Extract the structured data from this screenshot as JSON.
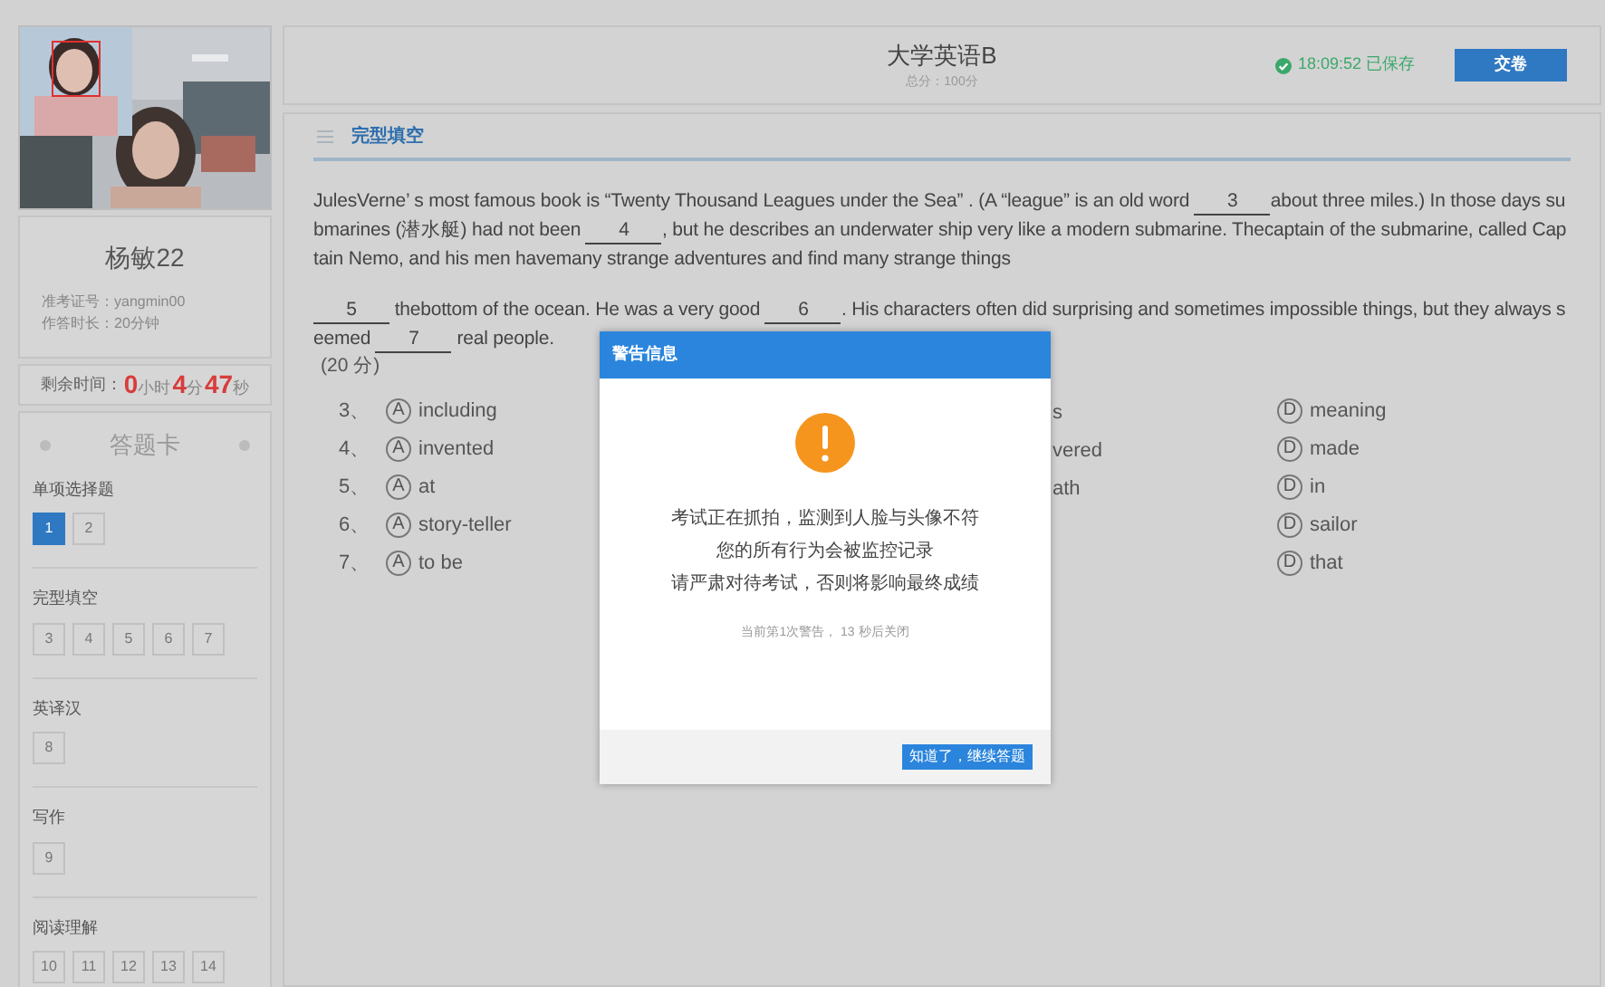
{
  "candidate": {
    "name": "杨敏22",
    "id_label": "准考证号：yangmin00",
    "duration_label": "作答时长：20分钟"
  },
  "timer": {
    "label": "剩余时间：",
    "parts": [
      {
        "value": "0",
        "unit": "小时"
      },
      {
        "value": "4",
        "unit": "分"
      },
      {
        "value": "47",
        "unit": "秒"
      }
    ]
  },
  "answer_card": {
    "title": "答题卡",
    "groups": [
      {
        "title": "单项选择题",
        "items": [
          {
            "label": "1",
            "selected": true
          },
          {
            "label": "2",
            "selected": false
          }
        ]
      },
      {
        "title": "完型填空",
        "items": [
          {
            "label": "3",
            "selected": false
          },
          {
            "label": "4",
            "selected": false
          },
          {
            "label": "5",
            "selected": false
          },
          {
            "label": "6",
            "selected": false
          },
          {
            "label": "7",
            "selected": false
          }
        ]
      },
      {
        "title": "英译汉",
        "items": [
          {
            "label": "8",
            "selected": false
          }
        ]
      },
      {
        "title": "写作",
        "items": [
          {
            "label": "9",
            "selected": false
          }
        ]
      },
      {
        "title": "阅读理解",
        "items": [
          {
            "label": "10",
            "selected": false
          },
          {
            "label": "11",
            "selected": false
          },
          {
            "label": "12",
            "selected": false
          },
          {
            "label": "13",
            "selected": false
          },
          {
            "label": "14",
            "selected": false
          }
        ]
      }
    ]
  },
  "header": {
    "title": "大学英语B",
    "subtitle": "总分：100分",
    "saved": "18:09:52 已保存",
    "submit": "交卷"
  },
  "section": {
    "title": "完型填空"
  },
  "passage": [
    [
      {
        "text": "JulesVerne’ s most famous book is  “Twenty Thousand Leagues under the Sea” . (A  “league”  is an old word "
      },
      {
        "blank": "3"
      },
      {
        "text": "about three miles.) In those days submarines (潜水艇) had not been "
      },
      {
        "blank": "4"
      },
      {
        "text": ", but he describes an underwater ship very like a modern submarine. Thecaptain of the submarine, called Captain Nemo, and his men havemany strange adventures and find many strange things"
      }
    ],
    [
      {
        "blank": "5"
      },
      {
        "text": " thebottom of the ocean. He was a very good "
      },
      {
        "blank": "6"
      },
      {
        "text": ". His characters often did surprising and sometimes impossible things, but they always seemed "
      },
      {
        "blank": "7"
      },
      {
        "text": " real people."
      }
    ]
  ],
  "score": "(20 分)",
  "questions": [
    {
      "number": "3、",
      "a": {
        "letter": "A",
        "text": "including"
      },
      "c": "s",
      "d": {
        "letter": "D",
        "text": "meaning"
      }
    },
    {
      "number": "4、",
      "a": {
        "letter": "A",
        "text": "invented"
      },
      "c": "vered",
      "d": {
        "letter": "D",
        "text": "made"
      }
    },
    {
      "number": "5、",
      "a": {
        "letter": "A",
        "text": "at"
      },
      "c": "ath",
      "d": {
        "letter": "D",
        "text": "in"
      }
    },
    {
      "number": "6、",
      "a": {
        "letter": "A",
        "text": "story-teller"
      },
      "d": {
        "letter": "D",
        "text": "sailor"
      }
    },
    {
      "number": "7、",
      "a": {
        "letter": "A",
        "text": "to be"
      },
      "d": {
        "letter": "D",
        "text": "that"
      }
    }
  ],
  "dialog": {
    "title": "警告信息",
    "lines": [
      "考试正在抓拍，监测到人脸与头像不符",
      "您的所有行为会被监控记录",
      "请严肃对待考试，否则将影响最终成绩"
    ],
    "note": "当前第1次警告， 13 秒后关闭",
    "button": "知道了，继续答题"
  }
}
